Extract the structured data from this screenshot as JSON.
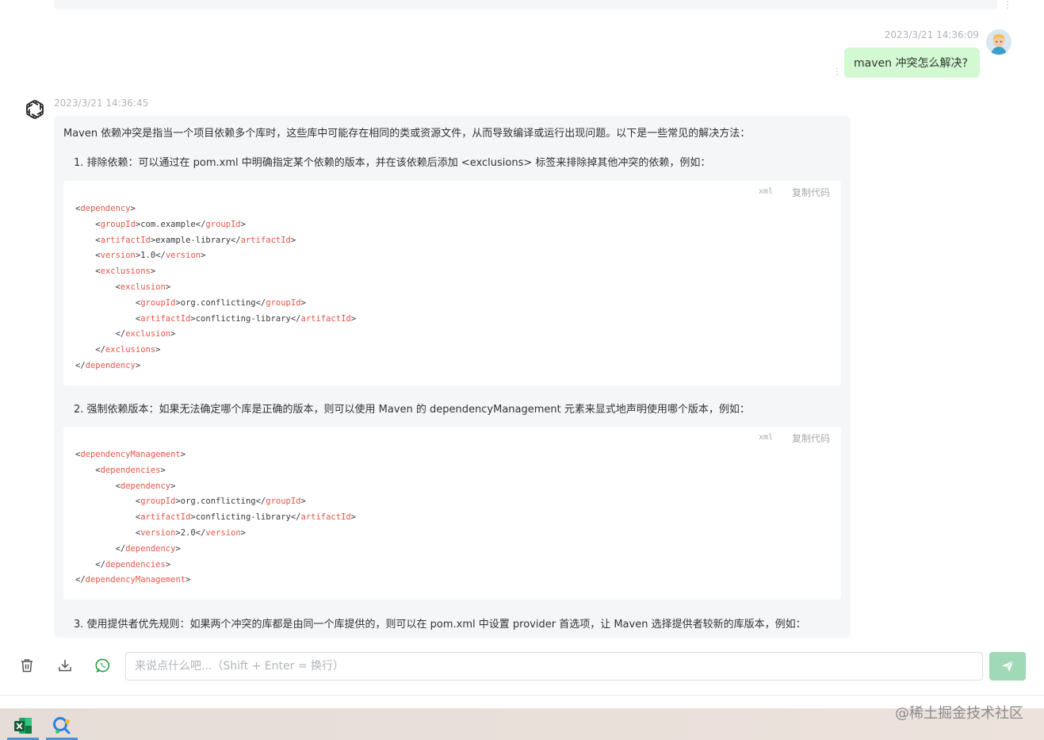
{
  "user_message": {
    "timestamp": "2023/3/21 14:36:09",
    "text": "maven 冲突怎么解决?"
  },
  "bot_message": {
    "timestamp": "2023/3/21 14:36:45",
    "intro": "Maven 依赖冲突是指当一个项目依赖多个库时，这些库中可能存在相同的类或资源文件，从而导致编译或运行出现问题。以下是一些常见的解决方法：",
    "step1": "1. 排除依赖：可以通过在 pom.xml 中明确指定某个依赖的版本，并在该依赖后添加 <exclusions> 标签来排除掉其他冲突的依赖，例如：",
    "step2": "2. 强制依赖版本：如果无法确定哪个库是正确的版本，则可以使用 Maven 的 dependencyManagement 元素来显式地声明使用哪个版本，例如：",
    "step3": "3. 使用提供者优先规则：如果两个冲突的库都是由同一个库提供的，则可以在 pom.xml 中设置 provider 首选项，让 Maven 选择提供者较新的库版本，例如：",
    "code_blocks": [
      {
        "lang": "xml",
        "copy_label": "复制代码",
        "lines": [
          {
            "indent": 0,
            "tag": "dependency",
            "kind": "open"
          },
          {
            "indent": 1,
            "tag": "groupId",
            "kind": "text",
            "text": "com.example"
          },
          {
            "indent": 1,
            "tag": "artifactId",
            "kind": "text",
            "text": "example-library"
          },
          {
            "indent": 1,
            "tag": "version",
            "kind": "text",
            "text": "1.0"
          },
          {
            "indent": 1,
            "tag": "exclusions",
            "kind": "open"
          },
          {
            "indent": 2,
            "tag": "exclusion",
            "kind": "open"
          },
          {
            "indent": 3,
            "tag": "groupId",
            "kind": "text",
            "text": "org.conflicting"
          },
          {
            "indent": 3,
            "tag": "artifactId",
            "kind": "text",
            "text": "conflicting-library"
          },
          {
            "indent": 2,
            "tag": "exclusion",
            "kind": "close"
          },
          {
            "indent": 1,
            "tag": "exclusions",
            "kind": "close"
          },
          {
            "indent": 0,
            "tag": "dependency",
            "kind": "close"
          }
        ]
      },
      {
        "lang": "xml",
        "copy_label": "复制代码",
        "lines": [
          {
            "indent": 0,
            "tag": "dependencyManagement",
            "kind": "open"
          },
          {
            "indent": 1,
            "tag": "dependencies",
            "kind": "open"
          },
          {
            "indent": 2,
            "tag": "dependency",
            "kind": "open"
          },
          {
            "indent": 3,
            "tag": "groupId",
            "kind": "text",
            "text": "org.conflicting"
          },
          {
            "indent": 3,
            "tag": "artifactId",
            "kind": "text",
            "text": "conflicting-library"
          },
          {
            "indent": 3,
            "tag": "version",
            "kind": "text",
            "text": "2.0"
          },
          {
            "indent": 2,
            "tag": "dependency",
            "kind": "close"
          },
          {
            "indent": 1,
            "tag": "dependencies",
            "kind": "close"
          },
          {
            "indent": 0,
            "tag": "dependencyManagement",
            "kind": "close"
          }
        ]
      }
    ]
  },
  "composer": {
    "placeholder": "来说点什么吧...（Shift + Enter = 换行）",
    "icons": [
      "trash-icon",
      "download-icon",
      "whatsapp-icon",
      "send-icon"
    ]
  },
  "taskbar": {
    "apps": [
      "excel-icon",
      "search-chat-icon"
    ],
    "watermark": "@稀土掘金技术社区"
  },
  "colors": {
    "user_bubble": "#d2f9d1",
    "bot_bubble": "#f4f6f8",
    "xml_tag": "#e45649",
    "send_button": "#a0d9b6",
    "whatsapp_green": "#25a244"
  }
}
